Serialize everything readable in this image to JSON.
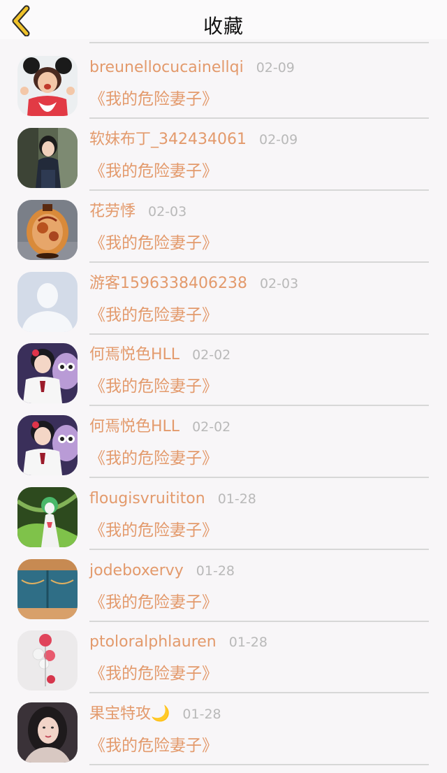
{
  "header": {
    "title": "收藏",
    "back_icon": "chevron-left-icon",
    "accent": "#efc22a"
  },
  "colors": {
    "name": "#e39a6c",
    "date": "#b9b9b9",
    "divider": "#d7d7d7"
  },
  "items": [
    {
      "name": "breunellocucainellqi",
      "date": "02-09",
      "work": "《我的危险妻子》",
      "avatar": "girl-mouse-ears-avatar"
    },
    {
      "name": "软妹布丁_342434061",
      "date": "02-09",
      "work": "《我的危险妻子》",
      "avatar": "girl-photo-avatar"
    },
    {
      "name": "花劳悸",
      "date": "02-03",
      "work": "《我的危险妻子》",
      "avatar": "vase-avatar"
    },
    {
      "name": "游客1596338406238",
      "date": "02-03",
      "work": "《我的危险妻子》",
      "avatar": "default-user-avatar"
    },
    {
      "name": "何焉悦色HLL",
      "date": "02-02",
      "work": "《我的危险妻子》",
      "avatar": "boy-owl-avatar"
    },
    {
      "name": "何焉悦色HLL",
      "date": "02-02",
      "work": "《我的危险妻子》",
      "avatar": "boy-owl-avatar"
    },
    {
      "name": "flougisvruititon",
      "date": "01-28",
      "work": "《我的危险妻子》",
      "avatar": "gardevoir-avatar"
    },
    {
      "name": "jodeboxervy",
      "date": "01-28",
      "work": "《我的危险妻子》",
      "avatar": "denim-avatar"
    },
    {
      "name": "ptoloralphlauren",
      "date": "01-28",
      "work": "《我的危险妻子》",
      "avatar": "balloon-avatar"
    },
    {
      "name": "果宝特攻🌙",
      "date": "01-28",
      "work": "《我的危险妻子》",
      "avatar": "girl-portrait-avatar"
    }
  ]
}
